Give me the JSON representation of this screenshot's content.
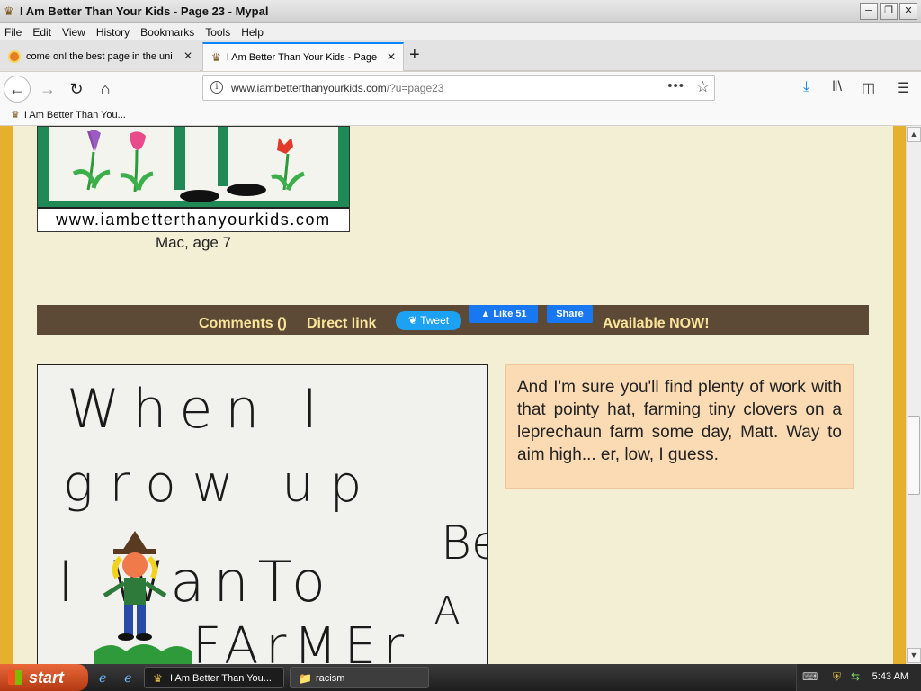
{
  "window": {
    "title": "I Am Better Than Your Kids - Page 23 - Mypal"
  },
  "menu": [
    "File",
    "Edit",
    "View",
    "History",
    "Bookmarks",
    "Tools",
    "Help"
  ],
  "tabs": [
    {
      "label": "come on! the best page in the uni",
      "active": false
    },
    {
      "label": "I Am Better Than Your Kids - Page",
      "active": true
    }
  ],
  "address": {
    "host": "www.iambetterthanyourkids.com",
    "path": "/?u=page23"
  },
  "bookmarks": [
    {
      "label": "I Am Better Than You..."
    }
  ],
  "post1": {
    "watermark": "www.iambetterthanyourkids.com",
    "caption": "Mac, age 7"
  },
  "commentbar": {
    "comments": "Comments ()",
    "direct_link": "Direct link",
    "tweet": "Tweet",
    "like": "Like 51",
    "share": "Share",
    "available": "Available NOW!"
  },
  "post2": {
    "drawing_text": [
      "When I",
      "grow up",
      "I WanTo",
      "Be",
      "A",
      "FArMEr"
    ],
    "comment": "And I'm sure you'll find plenty of work with that pointy hat, farming tiny clovers on a leprechaun farm some day, Matt. Way to aim high... er, low, I guess."
  },
  "taskbar": {
    "start": "start",
    "tasks": [
      "I Am Better Than You...",
      "racism"
    ],
    "clock": "5:43 AM"
  },
  "scroll": {
    "position_fraction": 0.6
  },
  "colors": {
    "border_gold": "#e6b02e",
    "bar_brown": "#5d4a36",
    "link_yellow": "#fbe59a",
    "comment_bg": "#fbdbb4",
    "page_bg": "#f3efd5"
  }
}
